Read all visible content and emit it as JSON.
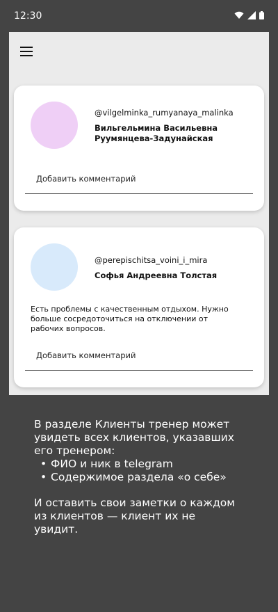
{
  "status_bar": {
    "time": "12:30",
    "icons": [
      "wifi-icon",
      "signal-icon",
      "battery-icon"
    ]
  },
  "app": {
    "menu_icon": "hamburger-menu-icon",
    "clients": [
      {
        "nick": "@vilgelminka_rumyanaya_malinka",
        "name": "Вильгельмина Васильевна Руумянцева-Задунайская",
        "about": "",
        "comment_placeholder": "Добавить комментарий",
        "avatar_color": "#efcff6"
      },
      {
        "nick": "@perepischitsa_voini_i_mira",
        "name": "Софья Андреевна Толстая",
        "about": "Есть проблемы с качественным отдыхом. Нужно больше сосредоточиться на отключении от рабочих вопросов.",
        "comment_placeholder": "Добавить комментарий",
        "avatar_color": "#d8eafb"
      }
    ]
  },
  "note": {
    "intro": "В разделе Клиенты тренер может увидеть всех клиентов, указавших его тренером:",
    "bullets": [
      "ФИО и ник в telegram",
      "Содержимое раздела «о себе»"
    ],
    "outro": "И оставить свои заметки о каждом из клиентов — клиент их не увидит."
  },
  "colors": {
    "background": "#444444",
    "screen": "#ebebeb",
    "card": "#ffffff"
  }
}
